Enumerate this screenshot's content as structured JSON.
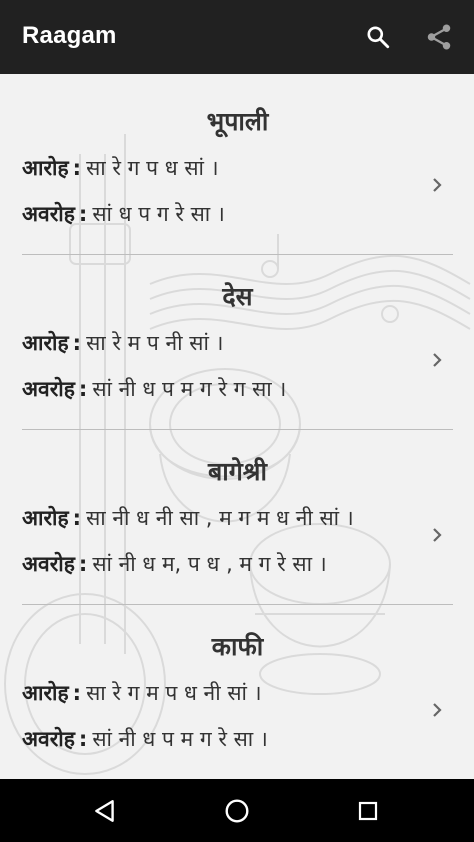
{
  "app": {
    "title": "Raagam"
  },
  "icons": {
    "search": "search-icon",
    "share": "share-icon",
    "chevron": "chevron-right-icon",
    "back": "back-triangle-icon",
    "home": "home-circle-icon",
    "recent": "recent-apps-square-icon"
  },
  "labels": {
    "aroh": "आरोह",
    "avaroh": "अवरोह",
    "colon": ":"
  },
  "raags": [
    {
      "name": "भूपाली",
      "aroh": "सा रे ग प ध सां ।",
      "avaroh": "सां ध प ग रे सा ।"
    },
    {
      "name": "देस",
      "aroh": "सा रे म प नी सां ।",
      "avaroh": "सां नी ध प म ग रे ग सा ।"
    },
    {
      "name": "बागेश्री",
      "aroh": "सा नी ध नी सा , म ग म ध नी सां ।",
      "avaroh": "सां नी ध म, प ध , म ग रे सा ।"
    },
    {
      "name": "काफी",
      "aroh": "सा रे ग म प ध नी सां ।",
      "avaroh": "सां नी ध प म ग रे सा ।"
    }
  ],
  "colors": {
    "app_bar": "#212121",
    "nav_bar": "#000000",
    "background": "#f2f2f2",
    "divider": "#bdbdbd"
  }
}
